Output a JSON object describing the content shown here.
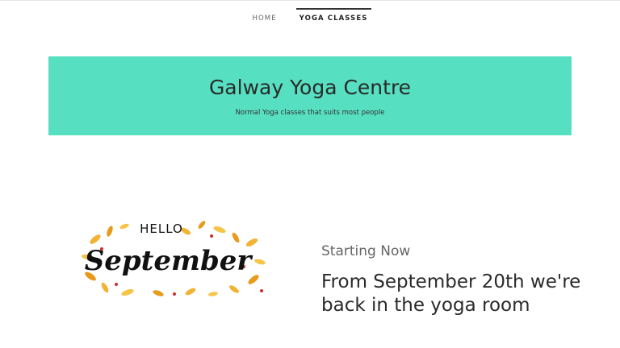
{
  "nav": {
    "items": [
      {
        "label": "HOME"
      },
      {
        "label": "YOGA CLASSES",
        "active": true
      }
    ]
  },
  "hero": {
    "title": "Galway Yoga Centre",
    "subtitle": "Normal Yoga classes that suits most people",
    "background_color": "#57dfc1"
  },
  "feature": {
    "image": {
      "lettering_top": "HELLO",
      "lettering_main": "September",
      "leaf_colors": [
        "#f2b233",
        "#e89a1c",
        "#f5c54a"
      ],
      "berry_color": "#c8302a"
    },
    "kicker": "Starting Now",
    "headline": "From September 20th we're back in the yoga room"
  }
}
